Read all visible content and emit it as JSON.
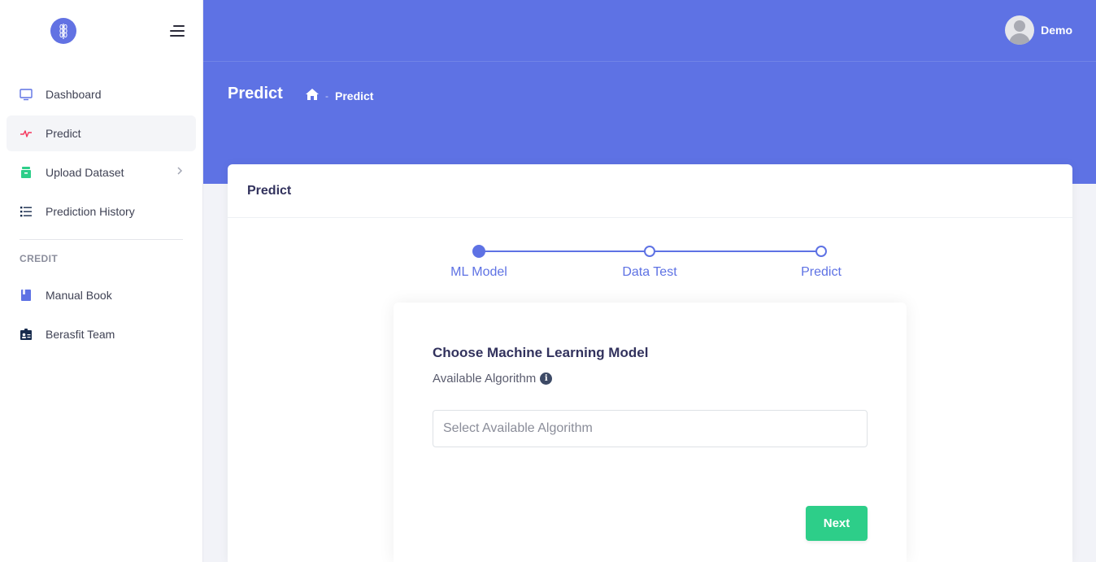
{
  "sidebar": {
    "items": [
      {
        "label": "Dashboard"
      },
      {
        "label": "Predict"
      },
      {
        "label": "Upload Dataset"
      },
      {
        "label": "Prediction History"
      }
    ],
    "section_title": "CREDIT",
    "credit_items": [
      {
        "label": "Manual Book"
      },
      {
        "label": "Berasfit Team"
      }
    ]
  },
  "header": {
    "user_name": "Demo"
  },
  "hero": {
    "title": "Predict",
    "breadcrumb_sep": "-",
    "breadcrumb_current": "Predict"
  },
  "card": {
    "title": "Predict",
    "steps": [
      {
        "label": "ML Model",
        "done": true
      },
      {
        "label": "Data Test",
        "done": false
      },
      {
        "label": "Predict",
        "done": false
      }
    ],
    "form": {
      "title": "Choose Machine Learning Model",
      "subtitle": "Available Algorithm",
      "select_placeholder": "Select Available Algorithm",
      "next_label": "Next"
    }
  },
  "colors": {
    "primary": "#5e72e4",
    "success": "#2dce89",
    "danger": "#f5365c"
  }
}
